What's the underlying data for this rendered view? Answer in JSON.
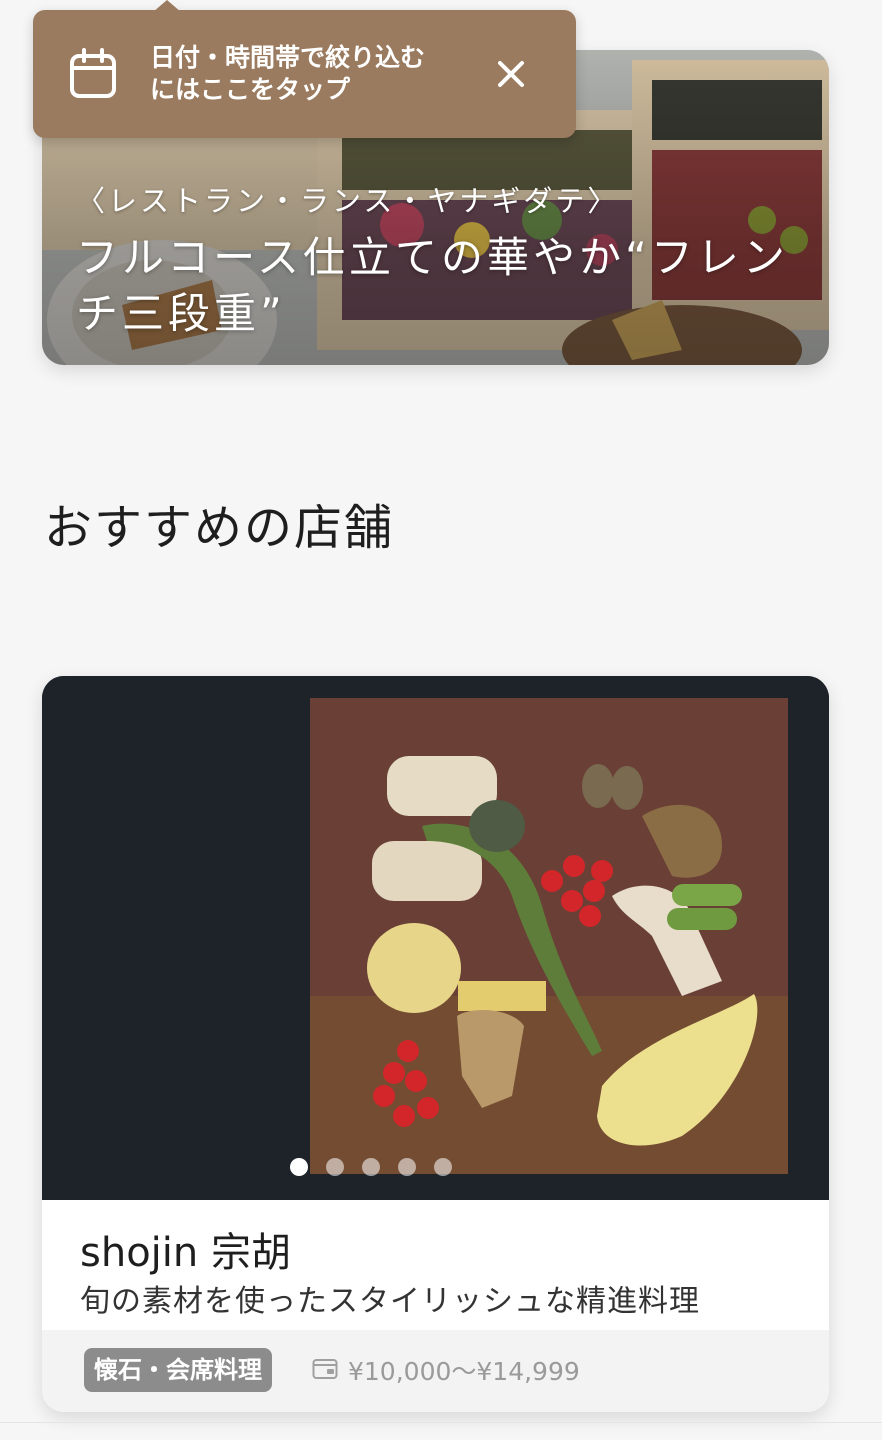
{
  "tooltip": {
    "text_line1": "日付・時間帯で絞り込む",
    "text_line2": "にはここをタップ",
    "icon": "calendar-icon",
    "close_icon": "close-icon",
    "background_color": "#9a7b5f"
  },
  "feature": {
    "restaurant": "〈レストラン・ランス・ヤナギダテ〉",
    "title": "フルコース仕立ての華やか“フレンチ三段重”",
    "image": "french-osechi-photo"
  },
  "section": {
    "title": "おすすめの店舗"
  },
  "store": {
    "name": "shojin 宗胡",
    "description": "旬の素材を使ったスタイリッシュな精進料理",
    "genre": "懐石・会席料理",
    "price_icon": "wallet-icon",
    "price": "¥10,000〜¥14,999",
    "image": "shojin-dish-photo",
    "carousel": {
      "count": 5,
      "active_index": 0
    }
  }
}
